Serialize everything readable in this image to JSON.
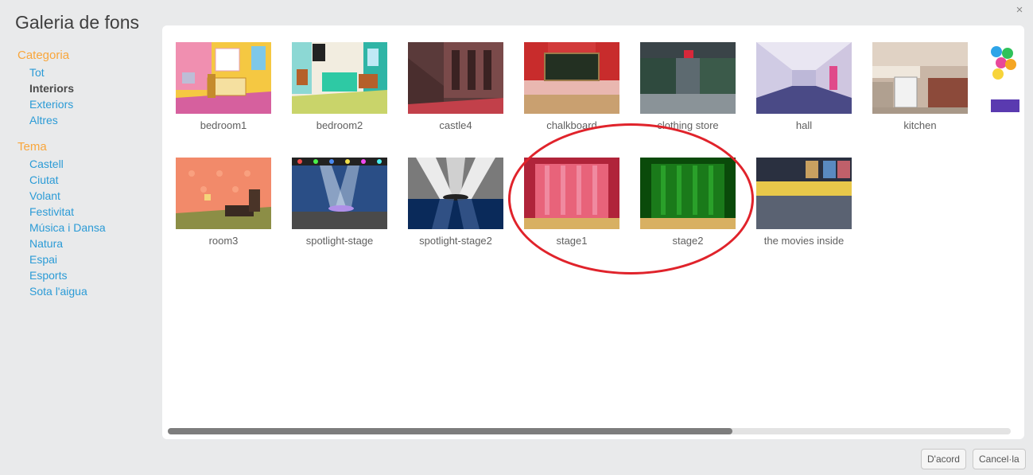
{
  "window": {
    "title": "Galeria de fons",
    "close_glyph": "×"
  },
  "sidebar": {
    "category_heading": "Categoria",
    "categories": [
      "Tot",
      "Interiors",
      "Exteriors",
      "Altres"
    ],
    "active_category": "Interiors",
    "theme_heading": "Tema",
    "themes": [
      "Castell",
      "Ciutat",
      "Volant",
      "Festivitat",
      "Música i Dansa",
      "Natura",
      "Espai",
      "Esports",
      "Sota l'aigua"
    ]
  },
  "gallery": {
    "items": [
      "bedroom1",
      "bedroom2",
      "castle4",
      "chalkboard",
      "clothing store",
      "hall",
      "kitchen",
      "room3",
      "spotlight-stage",
      "spotlight-stage2",
      "stage1",
      "stage2",
      "the movies inside"
    ]
  },
  "scrollbar": {
    "visible_fraction": 0.67
  },
  "buttons": {
    "ok": "D'acord",
    "cancel": "Cancel·la"
  },
  "annotation": {
    "color": "#e0232b"
  },
  "colors": {
    "accent_heading": "#f9a63b",
    "link": "#2b9bd6"
  }
}
